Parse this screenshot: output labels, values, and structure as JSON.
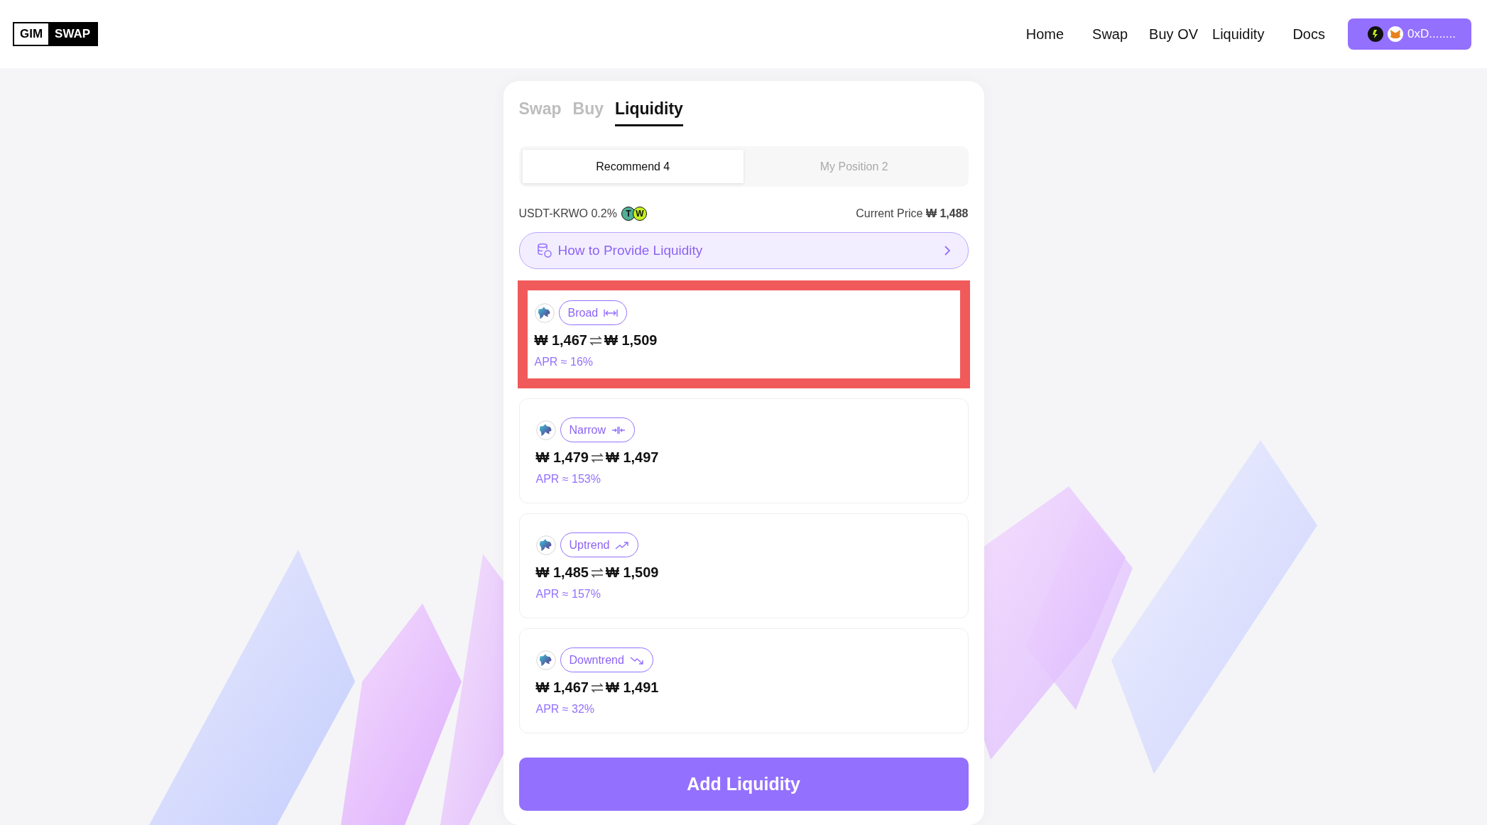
{
  "logo": {
    "left": "GIM",
    "right": "SWAP"
  },
  "nav": {
    "items": [
      {
        "label": "Home"
      },
      {
        "label": "Swap"
      },
      {
        "label": "Buy OV"
      },
      {
        "label": "Liquidity"
      },
      {
        "label": "Docs"
      }
    ],
    "wallet": {
      "address": "0xD........"
    }
  },
  "main_tabs": [
    {
      "label": "Swap",
      "selected": false
    },
    {
      "label": "Buy",
      "selected": false
    },
    {
      "label": "Liquidity",
      "selected": true
    }
  ],
  "sub_tabs": [
    {
      "label": "Recommend 4",
      "selected": true
    },
    {
      "label": "My Position 2",
      "selected": false
    }
  ],
  "pool": {
    "name": "USDT-KRWO 0.2%",
    "tokens": [
      {
        "symbol": "T",
        "color": "#50af95"
      },
      {
        "symbol": "W",
        "color": "#c6f21c"
      }
    ],
    "price_label": "Current Price",
    "price": "₩ 1,488"
  },
  "guide": {
    "label": "How to Provide Liquidity"
  },
  "strategies": [
    {
      "kind": "broad",
      "label": "Broad",
      "low": "₩ 1,467",
      "high": "₩ 1,509",
      "apr": "APR ≈ 16%",
      "selected": true
    },
    {
      "kind": "narrow",
      "label": "Narrow",
      "low": "₩ 1,479",
      "high": "₩ 1,497",
      "apr": "APR ≈ 153%",
      "selected": false
    },
    {
      "kind": "uptrend",
      "label": "Uptrend",
      "low": "₩ 1,485",
      "high": "₩ 1,509",
      "apr": "APR ≈ 157%",
      "selected": false
    },
    {
      "kind": "downtrend",
      "label": "Downtrend",
      "low": "₩ 1,467",
      "high": "₩ 1,491",
      "apr": "APR ≈ 32%",
      "selected": false
    }
  ],
  "action": {
    "label": "Add Liquidity"
  }
}
